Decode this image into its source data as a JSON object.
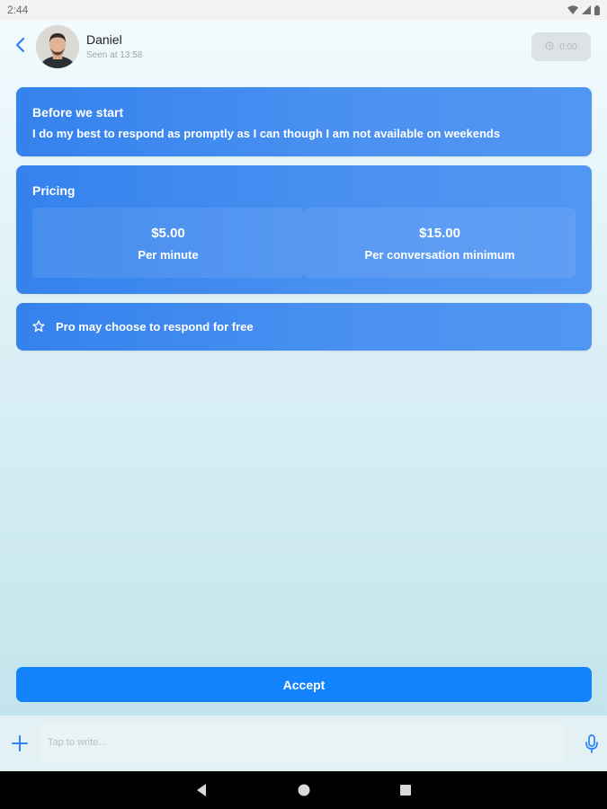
{
  "status_bar": {
    "time": "2:44"
  },
  "header": {
    "contact_name": "Daniel",
    "seen": "Seen at 13:58",
    "timer": "0:00"
  },
  "intro_card": {
    "title": "Before we start",
    "body": "I do my best to respond as promptly as I can though I am not available on weekends"
  },
  "pricing_card": {
    "title": "Pricing",
    "options": [
      {
        "amount": "$5.00",
        "label": "Per minute"
      },
      {
        "amount": "$15.00",
        "label": "Per conversation minimum"
      }
    ]
  },
  "free_card": {
    "text": "Pro may choose to respond for free"
  },
  "accept_label": "Accept",
  "compose": {
    "placeholder": "Tap to write..."
  },
  "colors": {
    "accent": "#1383fd",
    "card": "#3f8aef",
    "back_arrow": "#2a84f4"
  },
  "icons": [
    "back-arrow-icon",
    "clock-icon",
    "star-icon",
    "plus-icon",
    "mic-icon",
    "wifi-icon",
    "signal-icon",
    "battery-icon"
  ]
}
